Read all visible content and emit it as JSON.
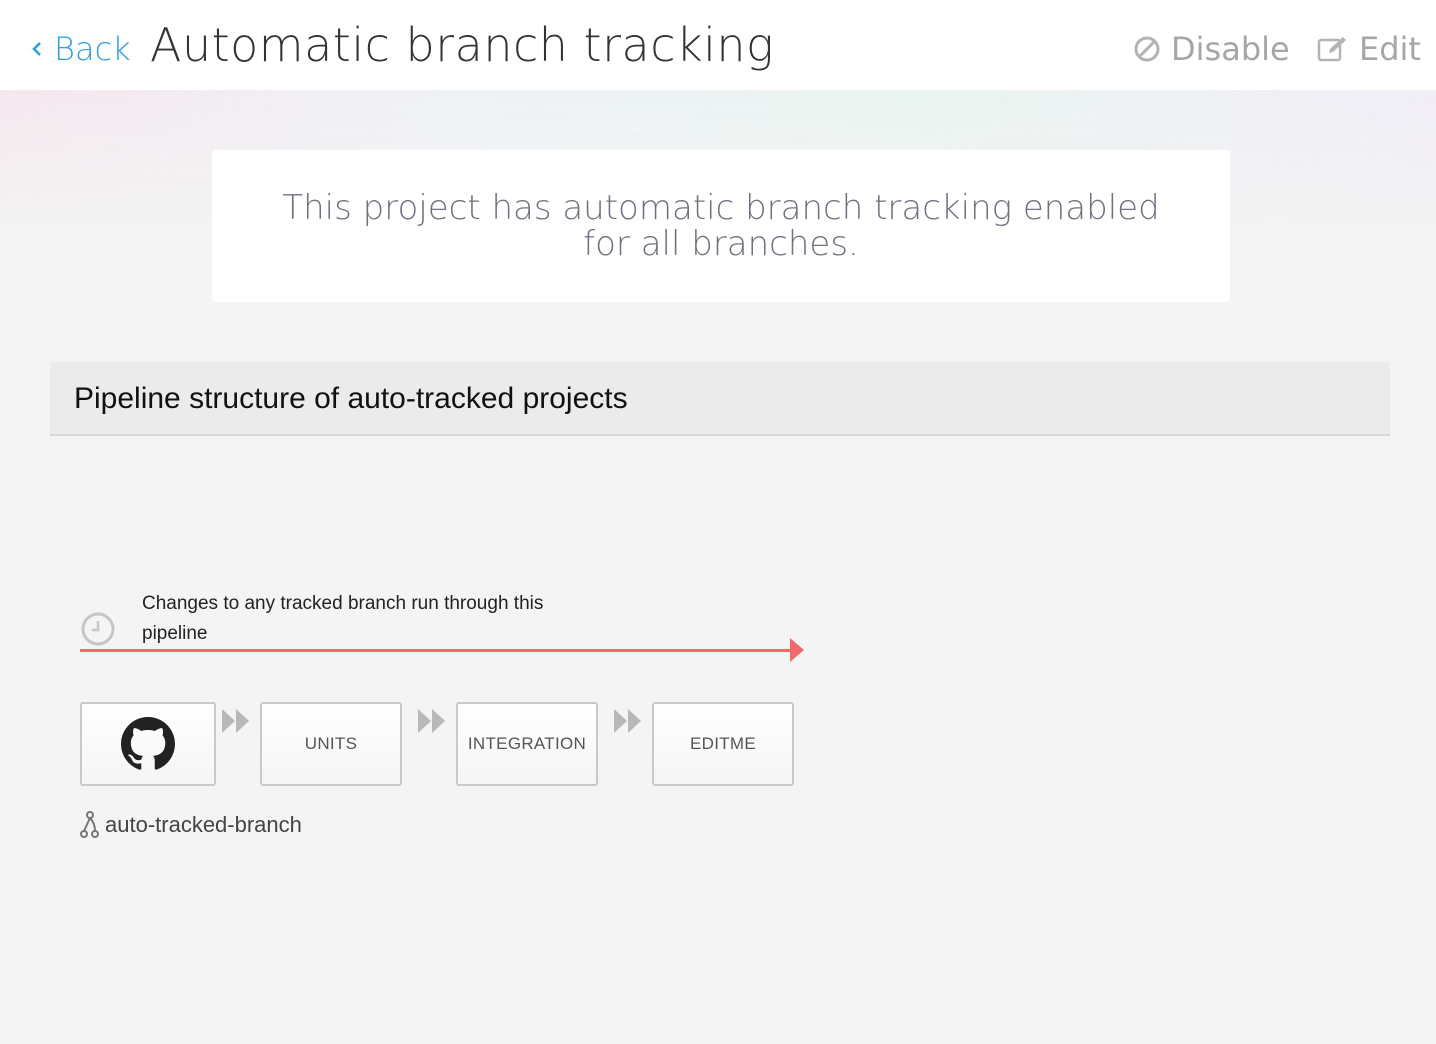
{
  "header": {
    "back_label": "Back",
    "title": "Automatic branch tracking",
    "disable_label": "Disable",
    "edit_label": "Edit"
  },
  "banner": {
    "message": "This project has automatic branch tracking enabled for all branches."
  },
  "section": {
    "title": "Pipeline structure of auto-tracked projects"
  },
  "pipeline": {
    "description": "Changes to any tracked branch run through this pipeline",
    "source_icon": "github-icon",
    "stages": [
      "UNITS",
      "INTEGRATION",
      "EDITME"
    ],
    "branch_name": "auto-tracked-branch"
  },
  "colors": {
    "accent": "#2a9fd8",
    "track_line": "#f06a6a",
    "muted": "#a6a6a6"
  }
}
